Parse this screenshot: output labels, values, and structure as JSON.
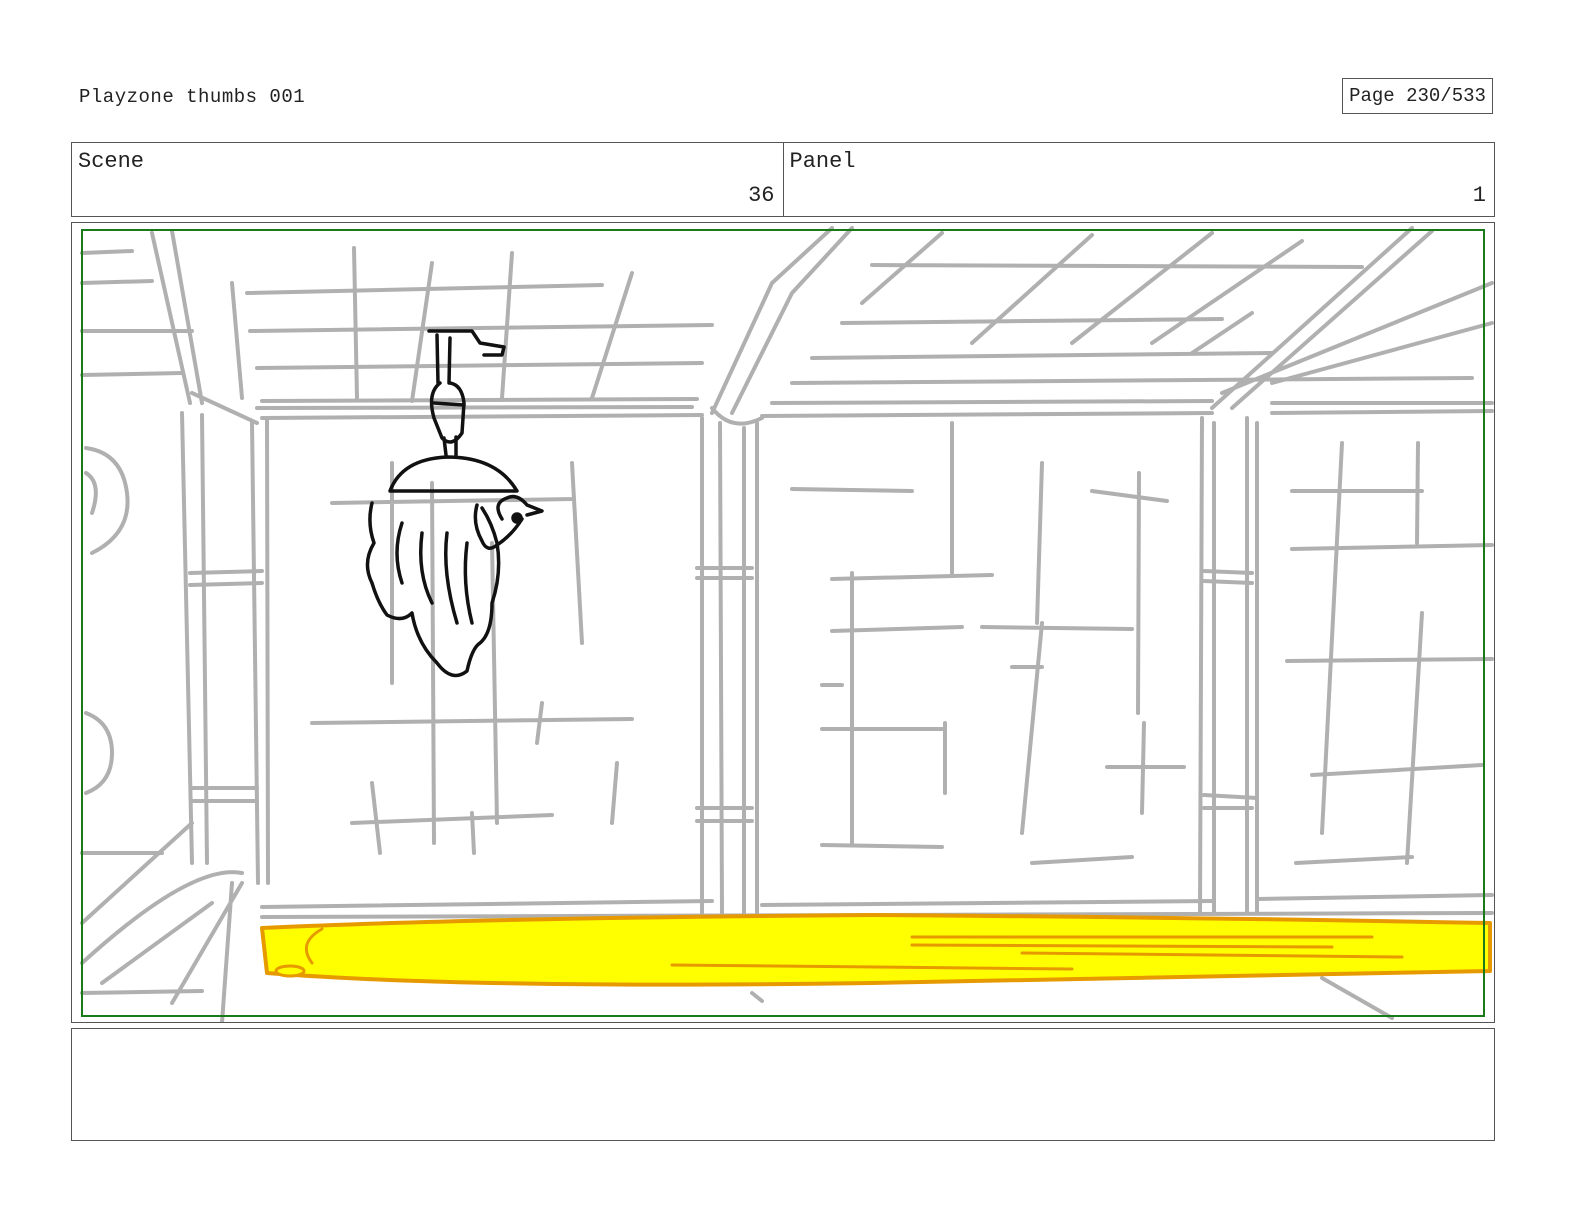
{
  "header": {
    "title": "Playzone thumbs 001",
    "page_label": "Page 230/533"
  },
  "info": {
    "scene_label": "Scene",
    "scene_value": "36",
    "panel_label": "Panel",
    "panel_value": "1"
  },
  "panel": {
    "safe_area_color": "#1a7a1a",
    "sketch_color": "#b0b0b0",
    "ink_color": "#111111",
    "goo_fill": "#ffff00",
    "goo_outline": "#e69a00"
  },
  "notes": {
    "text": ""
  }
}
